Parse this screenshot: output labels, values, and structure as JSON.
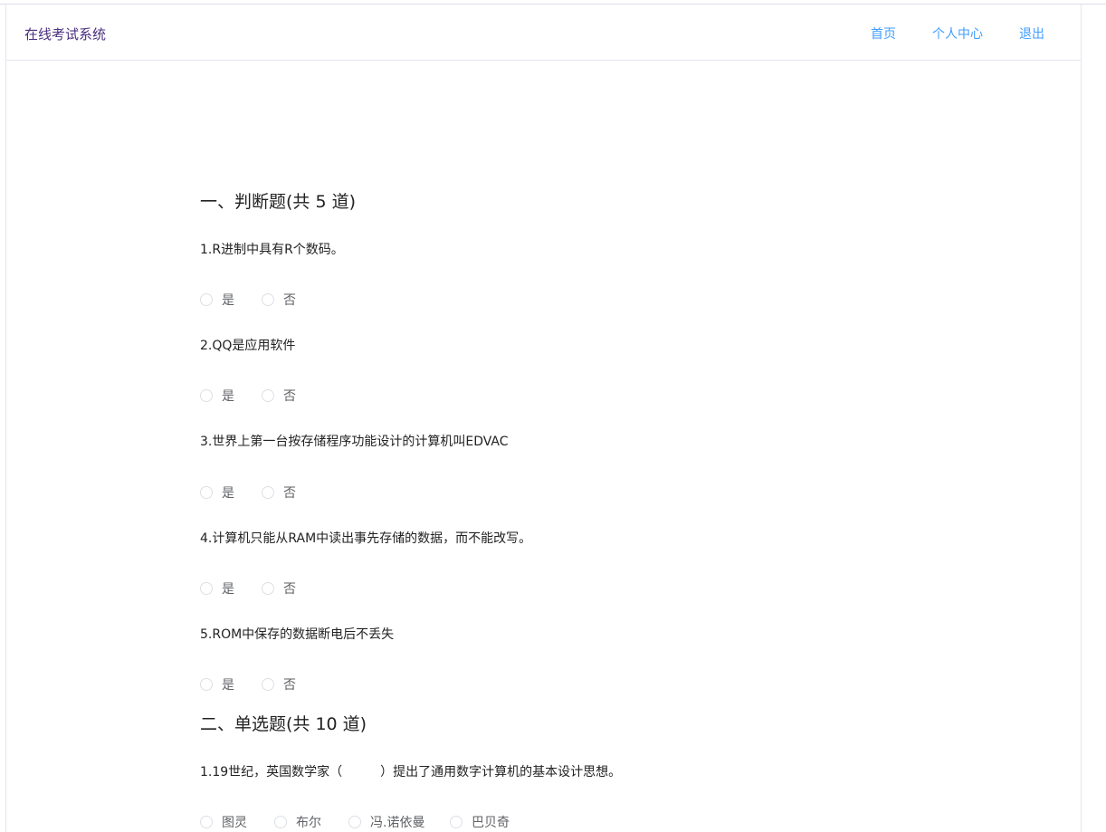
{
  "header": {
    "brand": "在线考试系统",
    "nav": {
      "home": "首页",
      "profile": "个人中心",
      "logout": "退出"
    }
  },
  "sections": [
    {
      "title": "一、判断题(共 5 道)",
      "questions": [
        {
          "text": "1.R进制中具有R个数码。",
          "options": [
            "是",
            "否"
          ]
        },
        {
          "text": "2.QQ是应用软件",
          "options": [
            "是",
            "否"
          ]
        },
        {
          "text": "3.世界上第一台按存储程序功能设计的计算机叫EDVAC",
          "options": [
            "是",
            "否"
          ]
        },
        {
          "text": "4.计算机只能从RAM中读出事先存储的数据，而不能改写。",
          "options": [
            "是",
            "否"
          ]
        },
        {
          "text": "5.ROM中保存的数据断电后不丢失",
          "options": [
            "是",
            "否"
          ]
        }
      ]
    },
    {
      "title": "二、单选题(共 10 道)",
      "questions": [
        {
          "text": "1.19世纪，英国数学家（　　　）提出了通用数字计算机的基本设计思想。",
          "options": [
            "图灵",
            "布尔",
            "冯.诺依曼",
            "巴贝奇"
          ]
        }
      ]
    }
  ]
}
